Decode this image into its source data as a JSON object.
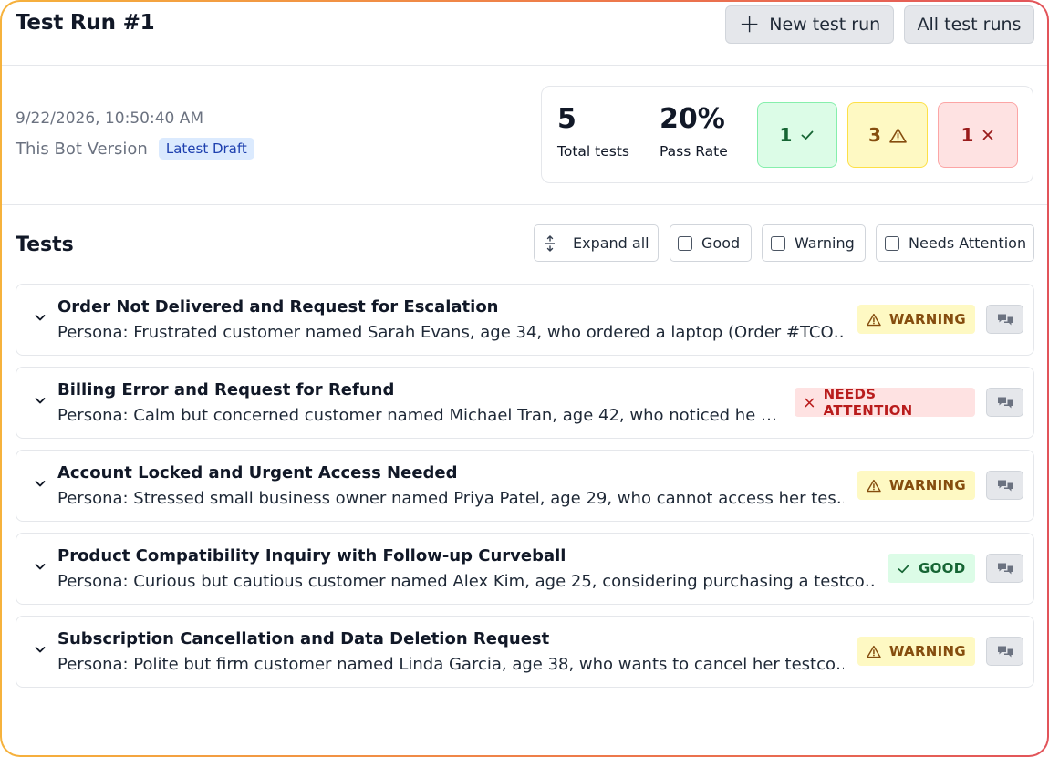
{
  "header": {
    "title": "Test Run #1",
    "new_run_label": "New test run",
    "all_runs_label": "All test runs"
  },
  "summary": {
    "timestamp": "9/22/2026, 10:50:40 AM",
    "bot_version_label": "This Bot Version",
    "bot_version_badge": "Latest Draft",
    "total_tests": "5",
    "total_tests_label": "Total tests",
    "pass_rate": "20%",
    "pass_rate_label": "Pass Rate",
    "good_count": "1",
    "warning_count": "3",
    "attention_count": "1"
  },
  "tests_section": {
    "title": "Tests",
    "expand_all_label": "Expand all",
    "filter_good_label": "Good",
    "filter_warning_label": "Warning",
    "filter_attention_label": "Needs Attention"
  },
  "tests": [
    {
      "title": "Order Not Delivered and Request for Escalation",
      "persona": "Persona: Frustrated customer named Sarah Evans, age 34, who ordered a laptop (Order #TCO…",
      "status": "WARNING"
    },
    {
      "title": "Billing Error and Request for Refund",
      "persona": "Persona: Calm but concerned customer named Michael Tran, age 42, who noticed he …",
      "status": "NEEDS ATTENTION"
    },
    {
      "title": "Account Locked and Urgent Access Needed",
      "persona": "Persona: Stressed small business owner named Priya Patel, age 29, who cannot access her tes…",
      "status": "WARNING"
    },
    {
      "title": "Product Compatibility Inquiry with Follow-up Curveball",
      "persona": "Persona: Curious but cautious customer named Alex Kim, age 25, considering purchasing a testco…",
      "status": "GOOD"
    },
    {
      "title": "Subscription Cancellation and Data Deletion Request",
      "persona": "Persona: Polite but firm customer named Linda Garcia, age 38, who wants to cancel her testco…",
      "status": "WARNING"
    }
  ],
  "colors": {
    "good_bg": "#dcfce7",
    "good_text": "#166534",
    "warning_bg": "#fef9c3",
    "warning_text": "#854d0e",
    "attention_bg": "#fee2e2",
    "attention_text": "#b91c1c",
    "badge_blue": "#dbeafe"
  },
  "icons": {
    "new_run": "plus-icon",
    "expand": "expand-vertical-icon",
    "row_toggle": "chevron-down-icon",
    "transcript": "chat-bubbles-icon",
    "good": "check-icon",
    "warning": "warning-triangle-icon",
    "attention": "x-icon"
  }
}
